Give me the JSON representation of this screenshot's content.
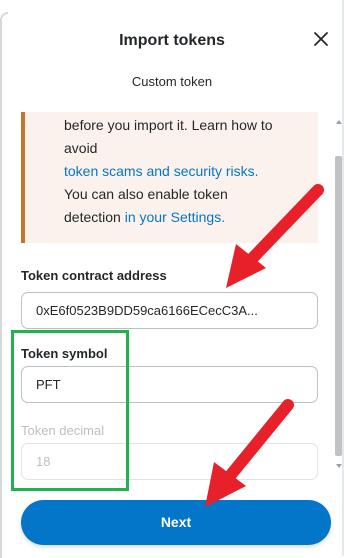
{
  "header": {
    "title": "Import tokens",
    "subtitle": "Custom token"
  },
  "warning": {
    "line1": "before you import it. Learn how to",
    "line2": "avoid",
    "link1": "token scams and security risks.",
    "line3": "You can also enable token",
    "line4_prefix": "detection ",
    "link2": "in your Settings."
  },
  "form": {
    "contract_label": "Token contract address",
    "contract_value": "0xE6f0523B9DD59ca6166ECecC3A...",
    "symbol_label": "Token symbol",
    "symbol_value": "PFT",
    "decimal_label": "Token decimal",
    "decimal_value": "18"
  },
  "actions": {
    "next_label": "Next"
  },
  "colors": {
    "accent": "#0376c9",
    "warning_bg": "#fcf2ed",
    "warning_border": "#c5762b",
    "highlight_green": "#22b14c",
    "annotation_red": "#e8202a"
  }
}
